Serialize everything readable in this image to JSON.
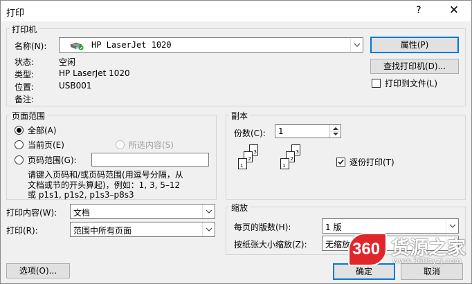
{
  "window": {
    "title": "打印",
    "help": "?",
    "close": "✕"
  },
  "printer": {
    "legend": "打印机",
    "name_label": "名称(N):",
    "name_value": "HP LaserJet 1020",
    "properties_btn": "属性(P)",
    "find_btn": "查找打印机(D)...",
    "print_to_file": "打印到文件(L)",
    "status_label": "状态:",
    "status_value": "空闲",
    "type_label": "类型:",
    "type_value": "HP LaserJet 1020",
    "where_label": "位置:",
    "where_value": "USB001",
    "comment_label": "备注:"
  },
  "range": {
    "legend": "页面范围",
    "all": "全部(A)",
    "current": "当前页(E)",
    "selection": "所选内容(S)",
    "pages": "页码范围(G):",
    "hint": [
      "请键入页码和/或页码范围(用逗号分隔，从",
      "文档或节的开头算起)，例如：1, 3, 5–12",
      "或 p1s1, p1s2, p1s3–p8s3"
    ]
  },
  "copies": {
    "legend": "副本",
    "count_label": "份数(C):",
    "count_value": "1",
    "collate": "逐份打印(T)",
    "pages_a": [
      "1",
      "2",
      "3"
    ],
    "pages_b": [
      "1",
      "2",
      "3"
    ]
  },
  "print_what": {
    "content_label": "打印内容(W):",
    "content_value": "文档",
    "print_label": "打印(R):",
    "print_value": "范围中所有页面"
  },
  "zoom": {
    "legend": "缩放",
    "pps_label": "每页的版数(H):",
    "pps_value": "1 版",
    "scale_label": "按纸张大小缩放(Z):",
    "scale_value": "无缩放"
  },
  "footer": {
    "options": "选项(O)...",
    "ok": "确定",
    "cancel": "取消"
  },
  "watermark": {
    "number": "360",
    "name": "货源之家",
    "url": "www.360hyzj.com"
  },
  "colors": {
    "accent": "#0078d7",
    "logo_red": "#e0262b"
  }
}
